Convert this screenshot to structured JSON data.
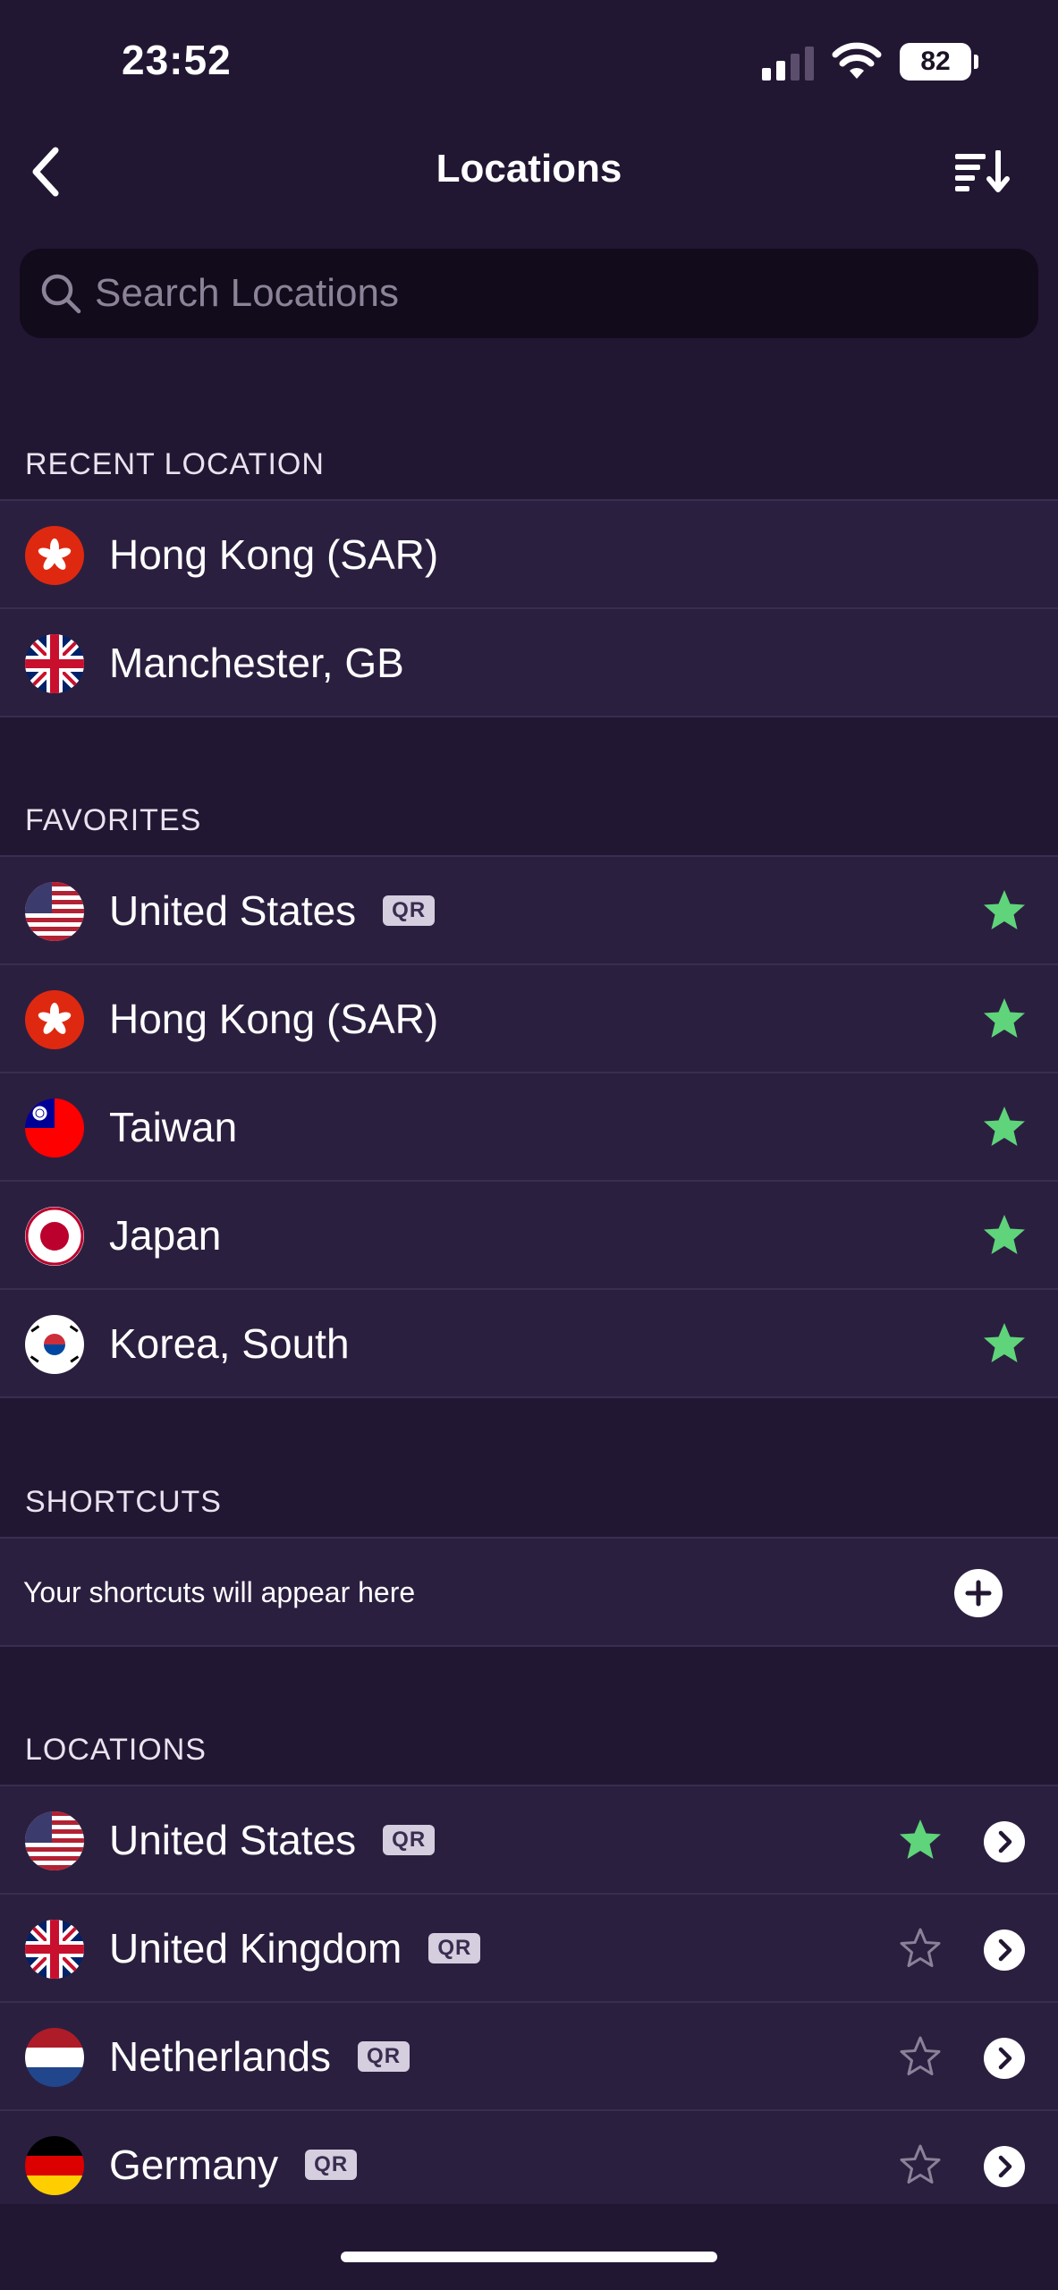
{
  "status_bar": {
    "time": "23:52",
    "battery": "82"
  },
  "nav": {
    "title": "Locations"
  },
  "search": {
    "placeholder": "Search Locations"
  },
  "sections": {
    "recent": {
      "title": "RECENT LOCATION",
      "items": [
        {
          "name": "Hong Kong (SAR)",
          "flag": "hong-kong-flag"
        },
        {
          "name": "Manchester, GB",
          "flag": "uk-flag"
        }
      ]
    },
    "favorites": {
      "title": "FAVORITES",
      "items": [
        {
          "name": "United States",
          "flag": "us-flag",
          "badge": "QR",
          "favorite": true
        },
        {
          "name": "Hong Kong (SAR)",
          "flag": "hong-kong-flag",
          "favorite": true
        },
        {
          "name": "Taiwan",
          "flag": "taiwan-flag",
          "favorite": true
        },
        {
          "name": "Japan",
          "flag": "japan-flag",
          "favorite": true
        },
        {
          "name": "Korea, South",
          "flag": "south-korea-flag",
          "favorite": true
        }
      ]
    },
    "shortcuts": {
      "title": "SHORTCUTS",
      "empty_text": "Your shortcuts will appear here"
    },
    "locations": {
      "title": "LOCATIONS",
      "items": [
        {
          "name": "United States",
          "flag": "us-flag",
          "badge": "QR",
          "favorite": true
        },
        {
          "name": "United Kingdom",
          "flag": "uk-flag",
          "badge": "QR",
          "favorite": false
        },
        {
          "name": "Netherlands",
          "flag": "netherlands-flag",
          "badge": "QR",
          "favorite": false
        },
        {
          "name": "Germany",
          "flag": "germany-flag",
          "badge": "QR",
          "favorite": false
        }
      ]
    }
  },
  "colors": {
    "background": "#221733",
    "row_background": "#2b1f40",
    "favorite_star": "#5fd47a",
    "empty_star": "#8a8298",
    "search_background": "#120b1c"
  }
}
